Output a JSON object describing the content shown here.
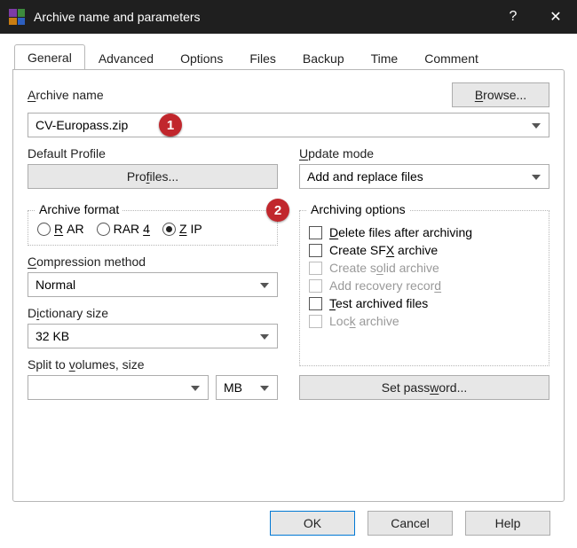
{
  "window": {
    "title": "Archive name and parameters"
  },
  "tabs": [
    "General",
    "Advanced",
    "Options",
    "Files",
    "Backup",
    "Time",
    "Comment"
  ],
  "active_tab": 0,
  "labels": {
    "archive_name": "Archive name",
    "browse": "Browse...",
    "default_profile": "Default Profile",
    "profiles": "Profiles...",
    "update_mode": "Update mode",
    "compression_method": "Compression method",
    "dictionary_size": "Dictionary size",
    "split": "Split to volumes, size",
    "set_password": "Set password...",
    "archive_format": "Archive format",
    "archiving_options": "Archiving options"
  },
  "values": {
    "archive_name": "CV-Europass.zip",
    "update_mode": "Add and replace files",
    "compression_method": "Normal",
    "dictionary_size": "32 KB",
    "split_size": "",
    "split_unit": "MB"
  },
  "formats": {
    "rar": "RAR",
    "rar4": "RAR4",
    "zip": "ZIP",
    "selected": "zip"
  },
  "options": {
    "delete_after": "Delete files after archiving",
    "create_sfx": "Create SFX archive",
    "create_solid": "Create solid archive",
    "add_recovery": "Add recovery record",
    "test_archived": "Test archived files",
    "lock_archive": "Lock archive"
  },
  "footer": {
    "ok": "OK",
    "cancel": "Cancel",
    "help": "Help"
  },
  "annotations": {
    "a1": "1",
    "a2": "2"
  }
}
